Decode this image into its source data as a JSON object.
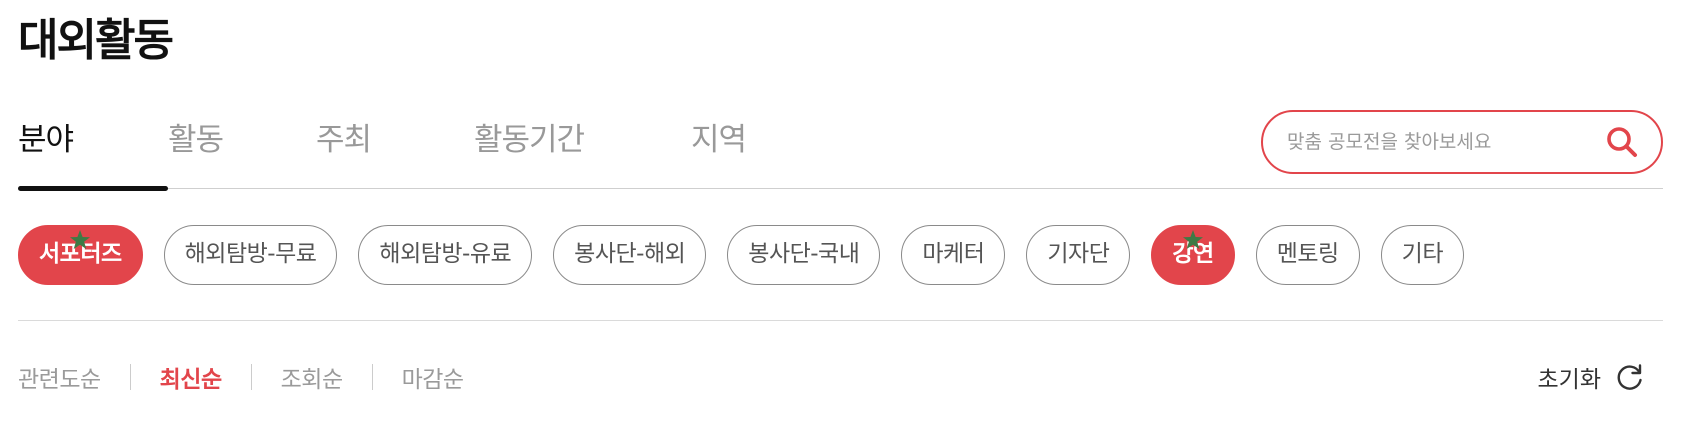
{
  "page": {
    "title": "대외활동"
  },
  "tabs": [
    {
      "label": "분야",
      "active": true
    },
    {
      "label": "활동",
      "active": false
    },
    {
      "label": "주최",
      "active": false
    },
    {
      "label": "활동기간",
      "active": false
    },
    {
      "label": "지역",
      "active": false
    }
  ],
  "search": {
    "placeholder": "맞춤 공모전을 찾아보세요",
    "value": ""
  },
  "categories": [
    {
      "label": "서포터즈",
      "selected": true,
      "starred": true
    },
    {
      "label": "해외탐방-무료",
      "selected": false,
      "starred": false
    },
    {
      "label": "해외탐방-유료",
      "selected": false,
      "starred": false
    },
    {
      "label": "봉사단-해외",
      "selected": false,
      "starred": false
    },
    {
      "label": "봉사단-국내",
      "selected": false,
      "starred": false
    },
    {
      "label": "마케터",
      "selected": false,
      "starred": false
    },
    {
      "label": "기자단",
      "selected": false,
      "starred": false
    },
    {
      "label": "강연",
      "selected": true,
      "starred": true
    },
    {
      "label": "멘토링",
      "selected": false,
      "starred": false
    },
    {
      "label": "기타",
      "selected": false,
      "starred": false
    }
  ],
  "sort": {
    "options": [
      {
        "label": "관련도순",
        "active": false
      },
      {
        "label": "최신순",
        "active": true
      },
      {
        "label": "조회순",
        "active": false
      },
      {
        "label": "마감순",
        "active": false
      }
    ],
    "reset_label": "초기화"
  },
  "colors": {
    "accent": "#e2454b",
    "star": "#3f7a45",
    "text_dark": "#111111",
    "text_muted": "#999999"
  },
  "icons": {
    "search": "search-icon",
    "star": "star-icon",
    "reset": "refresh-icon"
  }
}
